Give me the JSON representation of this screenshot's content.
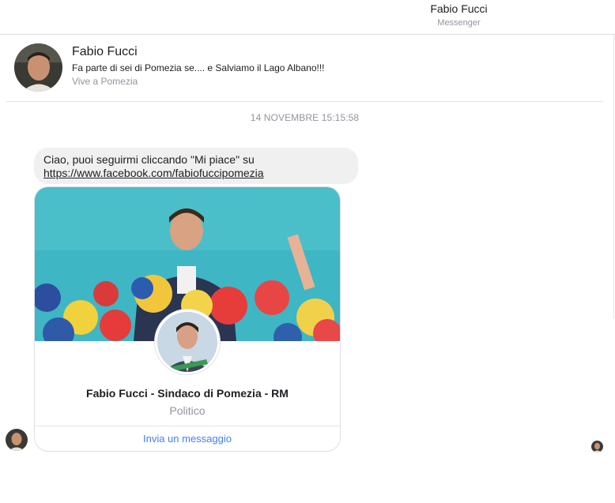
{
  "window": {
    "title": "Fabio Fucci",
    "subtitle": "Messenger"
  },
  "profile": {
    "name": "Fabio Fucci",
    "bio": "Fa parte di sei di Pomezia se.... e Salviamo il Lago Albano!!!",
    "location": "Vive a Pomezia"
  },
  "conversation": {
    "timestamp": "14 NOVEMBRE 15:15:58",
    "message": {
      "text": "Ciao, puoi seguirmi cliccando \"Mi piace\" su",
      "link": "https://www.facebook.com/fabiofuccipomezia"
    },
    "card": {
      "title": "Fabio Fucci - Sindaco di Pomezia - RM",
      "subtitle": "Politico",
      "action": "Invia un messaggio"
    }
  },
  "colors": {
    "link_blue": "#4080ff",
    "bubble": "#f1f0f0",
    "muted": "#90949c"
  }
}
